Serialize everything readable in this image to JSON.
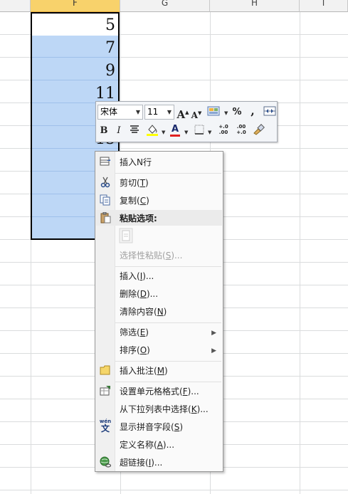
{
  "sheet": {
    "columns": [
      {
        "label": "F",
        "selected": true
      },
      {
        "label": "G",
        "selected": false
      },
      {
        "label": "H",
        "selected": false
      },
      {
        "label": "I",
        "selected": false
      }
    ],
    "cells": [
      "5",
      "7",
      "9",
      "11",
      "13",
      "15"
    ]
  },
  "mini_toolbar": {
    "font_name": "宋体",
    "font_size": "11",
    "grow_font": "A",
    "shrink_font": "A",
    "percent": "%",
    "comma": ",",
    "bold": "B",
    "italic": "I",
    "font_color": "A",
    "increase_decimal": "+.0 .00",
    "decrease_decimal": ".00 +.0"
  },
  "context_menu": {
    "insert_n_rows": {
      "text": "插入N行"
    },
    "cut": {
      "text": "剪切(",
      "key": "T",
      "after": ")"
    },
    "copy": {
      "text": "复制(",
      "key": "C",
      "after": ")"
    },
    "paste_options": {
      "text": "粘贴选项:"
    },
    "paste_special": {
      "text": "选择性粘贴(",
      "key": "S",
      "after": ")..."
    },
    "insert": {
      "text": "插入(",
      "key": "I",
      "after": ")..."
    },
    "delete": {
      "text": "删除(",
      "key": "D",
      "after": ")..."
    },
    "clear_contents": {
      "text": "清除内容(",
      "key": "N",
      "after": ")"
    },
    "filter": {
      "text": "筛选(",
      "key": "E",
      "after": ")"
    },
    "sort": {
      "text": "排序(",
      "key": "O",
      "after": ")"
    },
    "insert_comment": {
      "text": "插入批注(",
      "key": "M",
      "after": ")"
    },
    "format_cells": {
      "text": "设置单元格格式(",
      "key": "F",
      "after": ")..."
    },
    "pick_from_list": {
      "text": "从下拉列表中选择(",
      "key": "K",
      "after": ")..."
    },
    "phonetic": {
      "text": "显示拼音字段(",
      "key": "S",
      "after": ")"
    },
    "define_name": {
      "text": "定义名称(",
      "key": "A",
      "after": ")..."
    },
    "hyperlink": {
      "text": "超链接(",
      "key": "I",
      "after": ")..."
    }
  },
  "icons": {
    "phonetic_icon_text": "wén",
    "phonetic_icon_char": "文"
  },
  "colors": {
    "selection_fill": "#bdd7f6",
    "column_header_selected": "#f8d26b",
    "font_color_bar": "#e02020",
    "highlight_bar": "#ffff00"
  }
}
